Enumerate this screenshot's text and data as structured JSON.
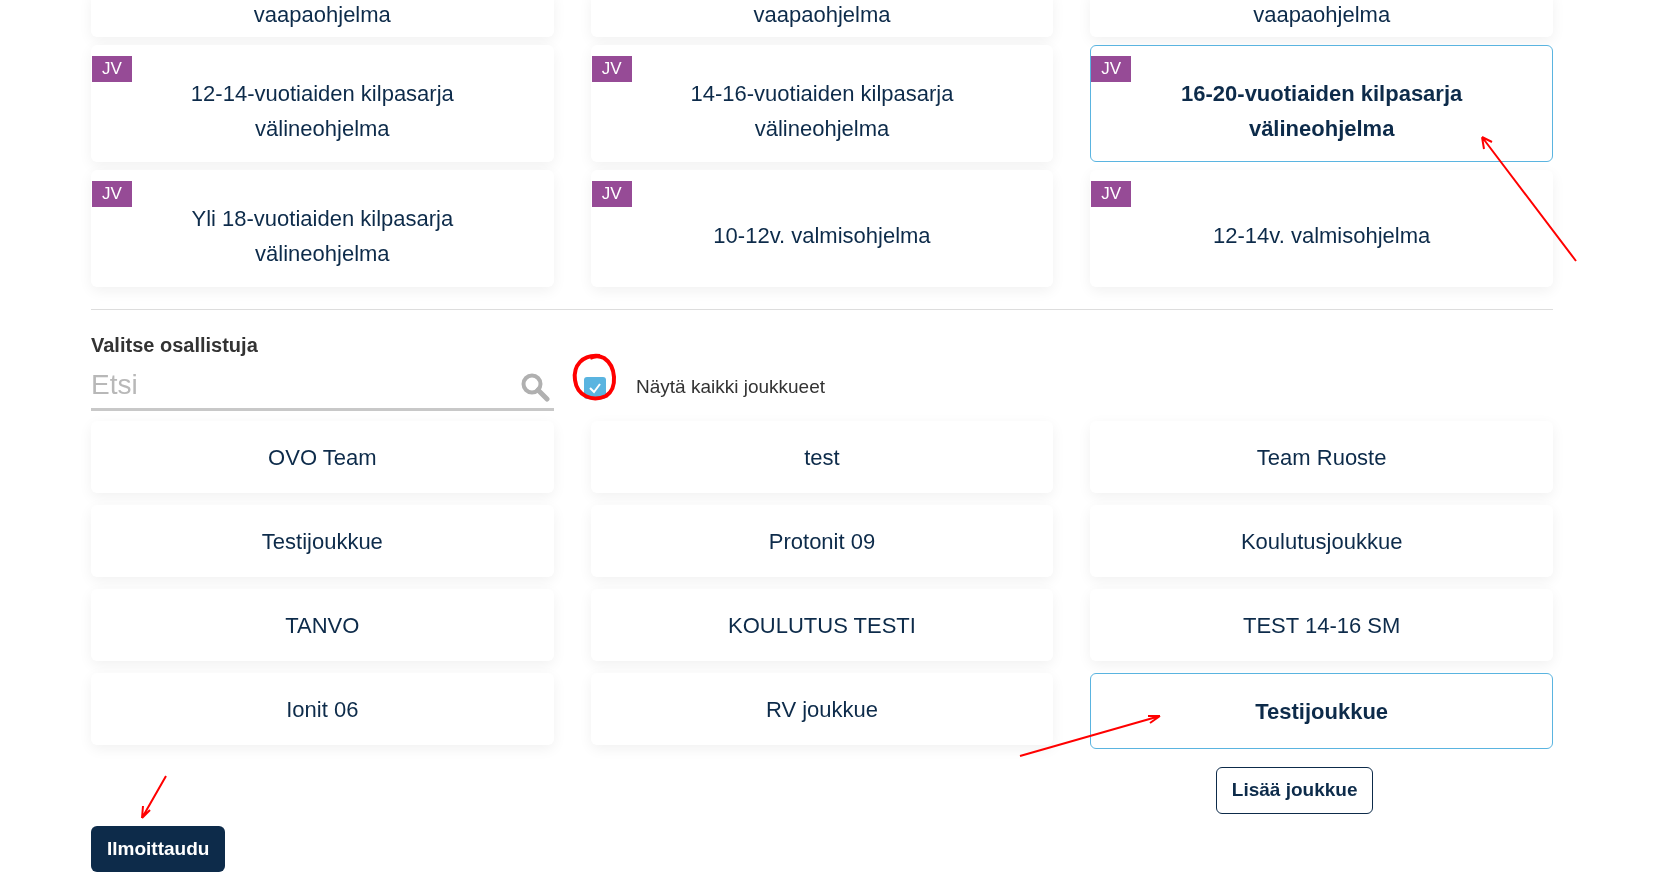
{
  "programs": [
    {
      "label": "vaapaohjelma",
      "selected": false
    },
    {
      "label": "vaapaohjelma",
      "selected": false
    },
    {
      "label": "vaapaohjelma",
      "selected": false
    },
    {
      "badge": "JV",
      "label": "12-14-vuotiaiden kilpasarja välineohjelma",
      "selected": false
    },
    {
      "badge": "JV",
      "label": "14-16-vuotiaiden kilpasarja välineohjelma",
      "selected": false
    },
    {
      "badge": "JV",
      "label": "16-20-vuotiaiden kilpasarja välineohjelma",
      "selected": true
    },
    {
      "badge": "JV",
      "label": "Yli 18-vuotiaiden kilpasarja välineohjelma",
      "selected": false
    },
    {
      "badge": "JV",
      "label": "10-12v. valmisohjelma",
      "selected": false
    },
    {
      "badge": "JV",
      "label": "12-14v. valmisohjelma",
      "selected": false
    }
  ],
  "participants": {
    "heading": "Valitse osallistuja",
    "search": {
      "placeholder": "Etsi"
    },
    "show_all": {
      "label": "Näytä kaikki joukkueet",
      "checked": true
    }
  },
  "teams": [
    {
      "label": "OVO Team",
      "selected": false
    },
    {
      "label": "test",
      "selected": false
    },
    {
      "label": "Team Ruoste",
      "selected": false
    },
    {
      "label": "Testijoukkue",
      "selected": false
    },
    {
      "label": "Protonit 09",
      "selected": false
    },
    {
      "label": "Koulutusjoukkue",
      "selected": false
    },
    {
      "label": "TANVO",
      "selected": false
    },
    {
      "label": "KOULUTUS TESTI",
      "selected": false
    },
    {
      "label": "TEST 14-16 SM",
      "selected": false
    },
    {
      "label": "Ionit 06",
      "selected": false
    },
    {
      "label": "RV joukkue",
      "selected": false
    },
    {
      "label": "Testijoukkue",
      "selected": true
    }
  ],
  "add_team_button": "Lisää joukkue",
  "submit_button": "Ilmoittaudu"
}
